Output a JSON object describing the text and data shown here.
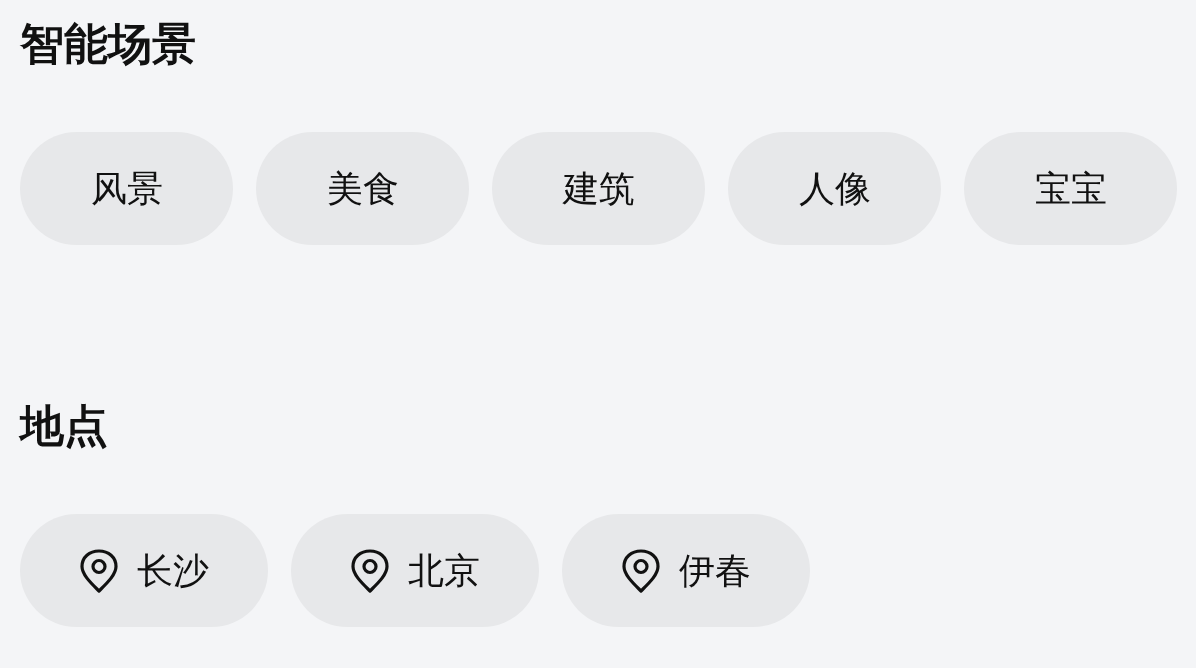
{
  "smart_scenes": {
    "title": "智能场景",
    "items": [
      "风景",
      "美食",
      "建筑",
      "人像",
      "宝宝"
    ]
  },
  "locations": {
    "title": "地点",
    "items": [
      "长沙",
      "北京",
      "伊春"
    ]
  }
}
